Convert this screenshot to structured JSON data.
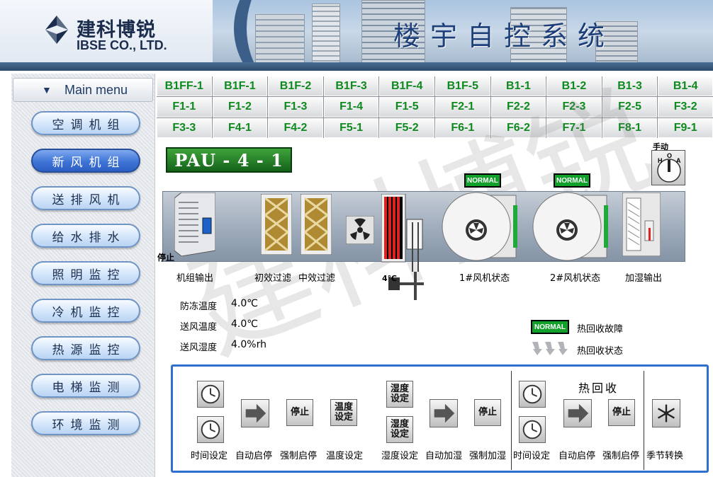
{
  "header": {
    "logo_cn": "建科博锐",
    "logo_en": "IBSE CO., LTD.",
    "system_title": "楼宇自控系统"
  },
  "sidebar": {
    "menu_title": "Main menu",
    "items": [
      {
        "label": "空调机组",
        "active": false
      },
      {
        "label": "新风机组",
        "active": true
      },
      {
        "label": "送排风机",
        "active": false
      },
      {
        "label": "给水排水",
        "active": false
      },
      {
        "label": "照明监控",
        "active": false
      },
      {
        "label": "冷机监控",
        "active": false
      },
      {
        "label": "热源监控",
        "active": false
      },
      {
        "label": "电梯监测",
        "active": false
      },
      {
        "label": "环境监测",
        "active": false
      }
    ]
  },
  "floors": [
    "B1FF-1",
    "B1F-1",
    "B1F-2",
    "B1F-3",
    "B1F-4",
    "B1F-5",
    "B1-1",
    "B1-2",
    "B1-3",
    "B1-4",
    "F1-1",
    "F1-2",
    "F1-3",
    "F1-4",
    "F1-5",
    "F2-1",
    "F2-2",
    "F2-3",
    "F2-5",
    "F3-2",
    "F3-3",
    "F4-1",
    "F4-2",
    "F5-1",
    "F5-2",
    "F6-1",
    "F6-2",
    "F7-1",
    "F8-1",
    "F9-1"
  ],
  "unit": {
    "title": "PAU - 4 - 1",
    "manual_label": "手动",
    "switch_labels": {
      "h": "H",
      "o": "O",
      "a": "A"
    },
    "stop_status": "停止",
    "valve_temp": "4℃",
    "fan1_status": "NORMAL",
    "fan2_status": "NORMAL",
    "components": {
      "unit_output": "机组输出",
      "primary_filter": "初效过滤",
      "medium_filter": "中效过滤",
      "fan1": "1#风机状态",
      "fan2": "2#风机状态",
      "humidifier_output": "加湿输出"
    },
    "readings": [
      {
        "label": "防冻温度",
        "value": "4.0℃"
      },
      {
        "label": "送风温度",
        "value": "4.0℃"
      },
      {
        "label": "送风湿度",
        "value": "4.0%rh"
      }
    ],
    "heat_recovery_fault_badge": "NORMAL",
    "heat_recovery_fault_label": "热回收故障",
    "heat_recovery_state_label": "热回收状态"
  },
  "panel": {
    "heat_recovery_title": "热回收",
    "stop_btn": "停止",
    "temp_set_btn": "温度\n设定",
    "humid_set_btn": "湿度\n设定",
    "labels": {
      "time_set": "时间设定",
      "auto_start": "自动启停",
      "force_start": "强制启停",
      "temp_set": "温度设定",
      "humid_set": "湿度设定",
      "auto_humid": "自动加湿",
      "force_humid": "强制加湿",
      "hr_time_set": "时间设定",
      "hr_auto_start": "自动启停",
      "hr_force_start": "强制启停",
      "season_switch": "季节转换"
    }
  },
  "watermark": "建科博锐",
  "colors": {
    "accent_blue": "#2f6fd0",
    "normal_green": "#11a02a",
    "floor_text": "#0e8a1e"
  }
}
